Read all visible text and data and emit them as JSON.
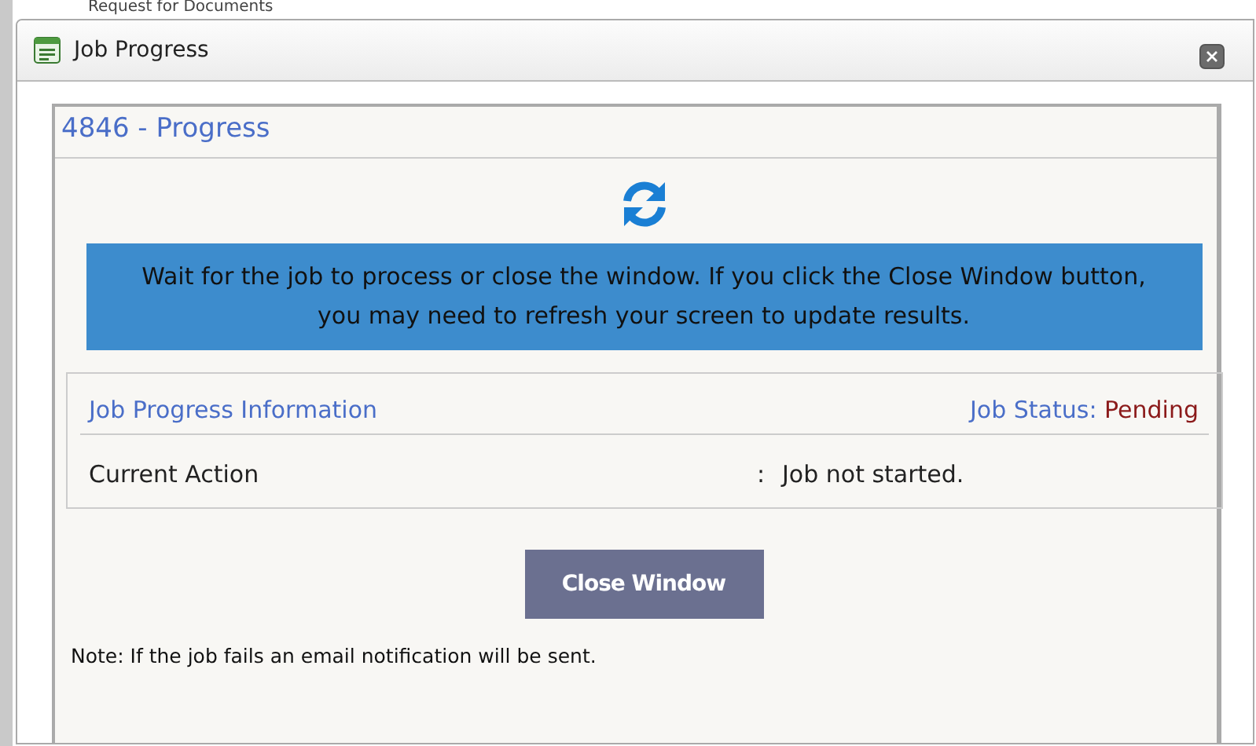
{
  "background": {
    "heading": "Request for Documents"
  },
  "window": {
    "title": "Job Progress"
  },
  "panel": {
    "title": "4846 - Progress"
  },
  "message": "Wait for the job to process or close the window. If you click the Close Window button, you may need to refresh your screen to update results.",
  "info": {
    "title": "Job Progress Information",
    "status_label": "Job Status:",
    "status_value": "Pending",
    "rows": [
      {
        "label": "Current Action",
        "separator": ":",
        "value": "Job not started."
      }
    ]
  },
  "buttons": [
    "Close Window"
  ],
  "note": "Note: If the job fails an email notification will be sent."
}
